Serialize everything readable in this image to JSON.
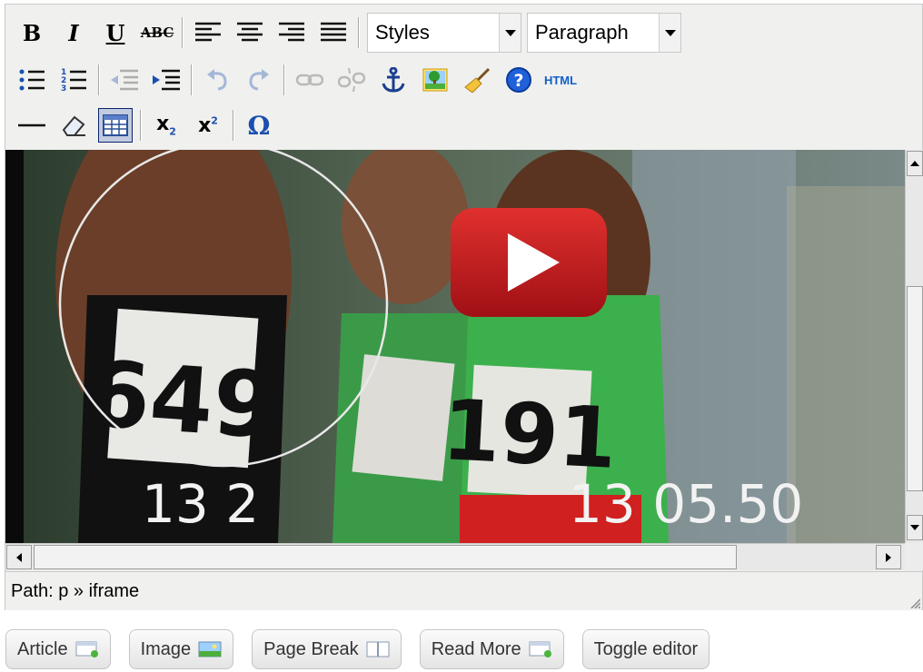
{
  "toolbar": {
    "bold_label": "B",
    "italic_label": "I",
    "underline_label": "U",
    "strikethrough_label": "ABC",
    "styles_select": "Styles",
    "format_select": "Paragraph",
    "html_label": "HTML",
    "subscript_label": "x",
    "superscript_label": "x",
    "charmap_label": "Ω"
  },
  "editor": {
    "path_label": "Path: p » iframe"
  },
  "buttons": {
    "article": "Article",
    "image": "Image",
    "page_break": "Page Break",
    "read_more": "Read More",
    "toggle_editor": "Toggle editor"
  },
  "video": {
    "bib_numbers": [
      "649",
      "191"
    ],
    "timecode_left": "13 2",
    "timecode_right": "13 05.50"
  },
  "colors": {
    "toolbar_bg": "#f0f0ee",
    "play_button": "#c4171d",
    "link_blue": "#1060c8"
  }
}
